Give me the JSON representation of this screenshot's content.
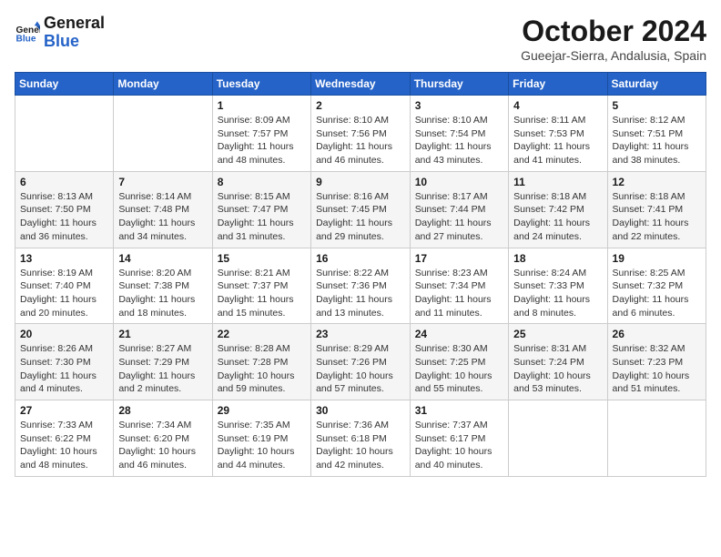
{
  "logo": {
    "text_general": "General",
    "text_blue": "Blue"
  },
  "title": "October 2024",
  "location": "Gueejar-Sierra, Andalusia, Spain",
  "weekdays": [
    "Sunday",
    "Monday",
    "Tuesday",
    "Wednesday",
    "Thursday",
    "Friday",
    "Saturday"
  ],
  "weeks": [
    [
      {
        "day": "",
        "detail": ""
      },
      {
        "day": "",
        "detail": ""
      },
      {
        "day": "1",
        "detail": "Sunrise: 8:09 AM\nSunset: 7:57 PM\nDaylight: 11 hours and 48 minutes."
      },
      {
        "day": "2",
        "detail": "Sunrise: 8:10 AM\nSunset: 7:56 PM\nDaylight: 11 hours and 46 minutes."
      },
      {
        "day": "3",
        "detail": "Sunrise: 8:10 AM\nSunset: 7:54 PM\nDaylight: 11 hours and 43 minutes."
      },
      {
        "day": "4",
        "detail": "Sunrise: 8:11 AM\nSunset: 7:53 PM\nDaylight: 11 hours and 41 minutes."
      },
      {
        "day": "5",
        "detail": "Sunrise: 8:12 AM\nSunset: 7:51 PM\nDaylight: 11 hours and 38 minutes."
      }
    ],
    [
      {
        "day": "6",
        "detail": "Sunrise: 8:13 AM\nSunset: 7:50 PM\nDaylight: 11 hours and 36 minutes."
      },
      {
        "day": "7",
        "detail": "Sunrise: 8:14 AM\nSunset: 7:48 PM\nDaylight: 11 hours and 34 minutes."
      },
      {
        "day": "8",
        "detail": "Sunrise: 8:15 AM\nSunset: 7:47 PM\nDaylight: 11 hours and 31 minutes."
      },
      {
        "day": "9",
        "detail": "Sunrise: 8:16 AM\nSunset: 7:45 PM\nDaylight: 11 hours and 29 minutes."
      },
      {
        "day": "10",
        "detail": "Sunrise: 8:17 AM\nSunset: 7:44 PM\nDaylight: 11 hours and 27 minutes."
      },
      {
        "day": "11",
        "detail": "Sunrise: 8:18 AM\nSunset: 7:42 PM\nDaylight: 11 hours and 24 minutes."
      },
      {
        "day": "12",
        "detail": "Sunrise: 8:18 AM\nSunset: 7:41 PM\nDaylight: 11 hours and 22 minutes."
      }
    ],
    [
      {
        "day": "13",
        "detail": "Sunrise: 8:19 AM\nSunset: 7:40 PM\nDaylight: 11 hours and 20 minutes."
      },
      {
        "day": "14",
        "detail": "Sunrise: 8:20 AM\nSunset: 7:38 PM\nDaylight: 11 hours and 18 minutes."
      },
      {
        "day": "15",
        "detail": "Sunrise: 8:21 AM\nSunset: 7:37 PM\nDaylight: 11 hours and 15 minutes."
      },
      {
        "day": "16",
        "detail": "Sunrise: 8:22 AM\nSunset: 7:36 PM\nDaylight: 11 hours and 13 minutes."
      },
      {
        "day": "17",
        "detail": "Sunrise: 8:23 AM\nSunset: 7:34 PM\nDaylight: 11 hours and 11 minutes."
      },
      {
        "day": "18",
        "detail": "Sunrise: 8:24 AM\nSunset: 7:33 PM\nDaylight: 11 hours and 8 minutes."
      },
      {
        "day": "19",
        "detail": "Sunrise: 8:25 AM\nSunset: 7:32 PM\nDaylight: 11 hours and 6 minutes."
      }
    ],
    [
      {
        "day": "20",
        "detail": "Sunrise: 8:26 AM\nSunset: 7:30 PM\nDaylight: 11 hours and 4 minutes."
      },
      {
        "day": "21",
        "detail": "Sunrise: 8:27 AM\nSunset: 7:29 PM\nDaylight: 11 hours and 2 minutes."
      },
      {
        "day": "22",
        "detail": "Sunrise: 8:28 AM\nSunset: 7:28 PM\nDaylight: 10 hours and 59 minutes."
      },
      {
        "day": "23",
        "detail": "Sunrise: 8:29 AM\nSunset: 7:26 PM\nDaylight: 10 hours and 57 minutes."
      },
      {
        "day": "24",
        "detail": "Sunrise: 8:30 AM\nSunset: 7:25 PM\nDaylight: 10 hours and 55 minutes."
      },
      {
        "day": "25",
        "detail": "Sunrise: 8:31 AM\nSunset: 7:24 PM\nDaylight: 10 hours and 53 minutes."
      },
      {
        "day": "26",
        "detail": "Sunrise: 8:32 AM\nSunset: 7:23 PM\nDaylight: 10 hours and 51 minutes."
      }
    ],
    [
      {
        "day": "27",
        "detail": "Sunrise: 7:33 AM\nSunset: 6:22 PM\nDaylight: 10 hours and 48 minutes."
      },
      {
        "day": "28",
        "detail": "Sunrise: 7:34 AM\nSunset: 6:20 PM\nDaylight: 10 hours and 46 minutes."
      },
      {
        "day": "29",
        "detail": "Sunrise: 7:35 AM\nSunset: 6:19 PM\nDaylight: 10 hours and 44 minutes."
      },
      {
        "day": "30",
        "detail": "Sunrise: 7:36 AM\nSunset: 6:18 PM\nDaylight: 10 hours and 42 minutes."
      },
      {
        "day": "31",
        "detail": "Sunrise: 7:37 AM\nSunset: 6:17 PM\nDaylight: 10 hours and 40 minutes."
      },
      {
        "day": "",
        "detail": ""
      },
      {
        "day": "",
        "detail": ""
      }
    ]
  ]
}
